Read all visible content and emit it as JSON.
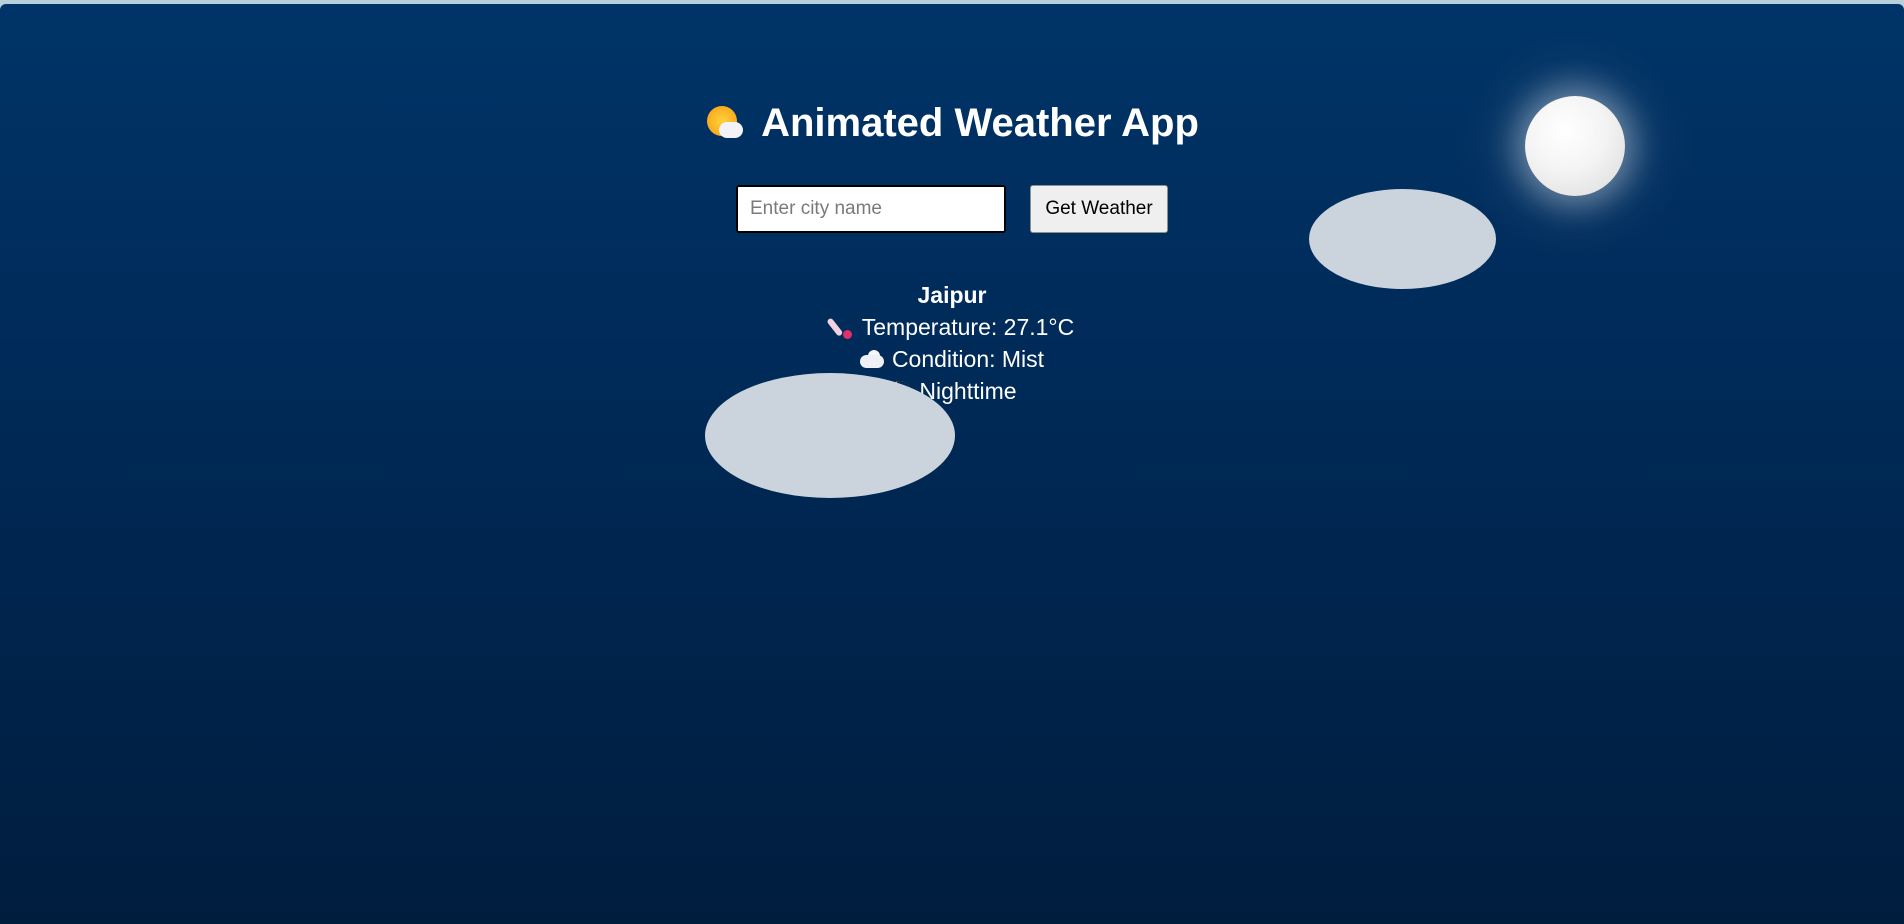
{
  "app": {
    "title": "Animated Weather App",
    "title_icon": "sun-behind-cloud-icon"
  },
  "search": {
    "placeholder": "Enter city name",
    "value": "",
    "button_label": "Get Weather"
  },
  "weather": {
    "city": "Jaipur",
    "temperature_line": "Temperature: 27.1°C",
    "temperature_icon": "thermometer-icon",
    "condition_line": "Condition: Mist",
    "condition_icon": "cloud-icon",
    "time_of_day": "Nighttime",
    "time_icon": "crescent-moon-icon"
  },
  "scene": {
    "sky_top_color": "#003468",
    "sky_bottom_color": "#001d3e",
    "moon": "moon-icon",
    "cloud_color": "#cbd4dd"
  }
}
